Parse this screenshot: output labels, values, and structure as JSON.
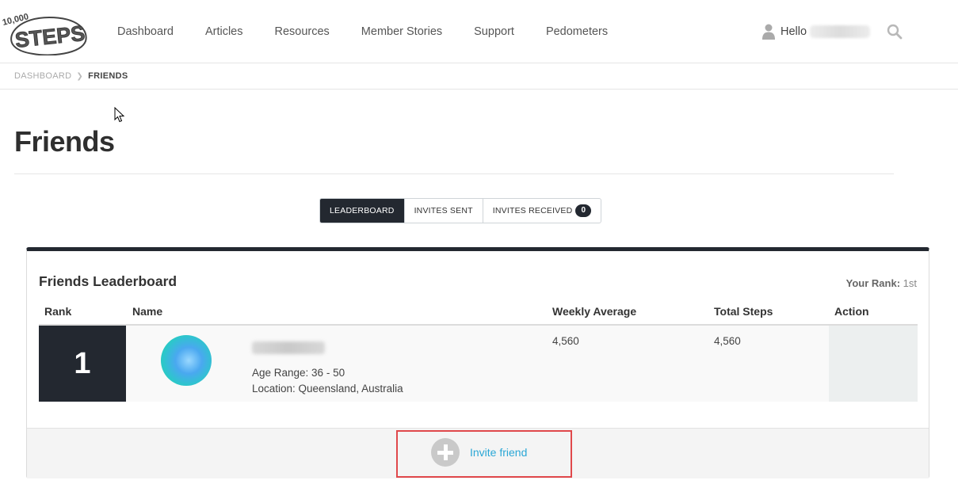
{
  "header": {
    "logo": {
      "text_top": "10,000",
      "text_main": "STEPS"
    },
    "nav": [
      "Dashboard",
      "Articles",
      "Resources",
      "Member Stories",
      "Support",
      "Pedometers"
    ],
    "greeting": "Hello"
  },
  "breadcrumb": {
    "parent": "DASHBOARD",
    "current": "FRIENDS"
  },
  "page": {
    "title": "Friends"
  },
  "tabs": {
    "leaderboard": "LEADERBOARD",
    "invites_sent": "INVITES SENT",
    "invites_received": "INVITES RECEIVED",
    "invites_received_count": "0"
  },
  "leaderboard": {
    "title": "Friends Leaderboard",
    "your_rank_label": "Your Rank:",
    "your_rank_value": "1st",
    "columns": [
      "Rank",
      "Name",
      "Weekly Average",
      "Total Steps",
      "Action"
    ],
    "rows": [
      {
        "rank": "1",
        "age_range": "Age Range: 36 - 50",
        "location": "Location: Queensland, Australia",
        "weekly_average": "4,560",
        "total_steps": "4,560"
      }
    ],
    "invite_label": "Invite friend"
  },
  "colors": {
    "dark": "#232830",
    "link": "#2aa7d6",
    "highlight": "#e0484b"
  }
}
